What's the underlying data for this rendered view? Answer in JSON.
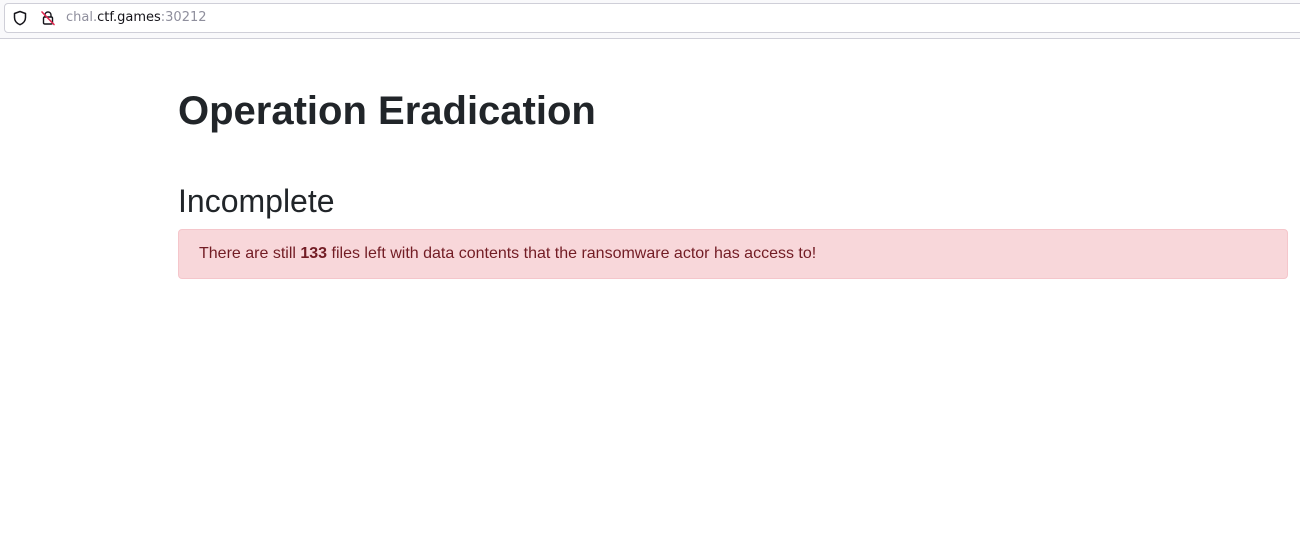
{
  "browser": {
    "url_prefix": "chal.",
    "url_host": "ctf.games",
    "url_port": ":30212",
    "icons": [
      "shield-icon",
      "insecure-lock-icon"
    ]
  },
  "page": {
    "title": "Operation Eradication",
    "status_heading": "Incomplete",
    "alert": {
      "text_before": "There are still ",
      "count": "133",
      "text_after": " files left with data contents that the ransomware actor has access to!"
    }
  },
  "colors": {
    "alert_background": "#f8d7da",
    "alert_border": "#f5c6cb",
    "alert_text": "#721c24",
    "heading_text": "#212529"
  }
}
